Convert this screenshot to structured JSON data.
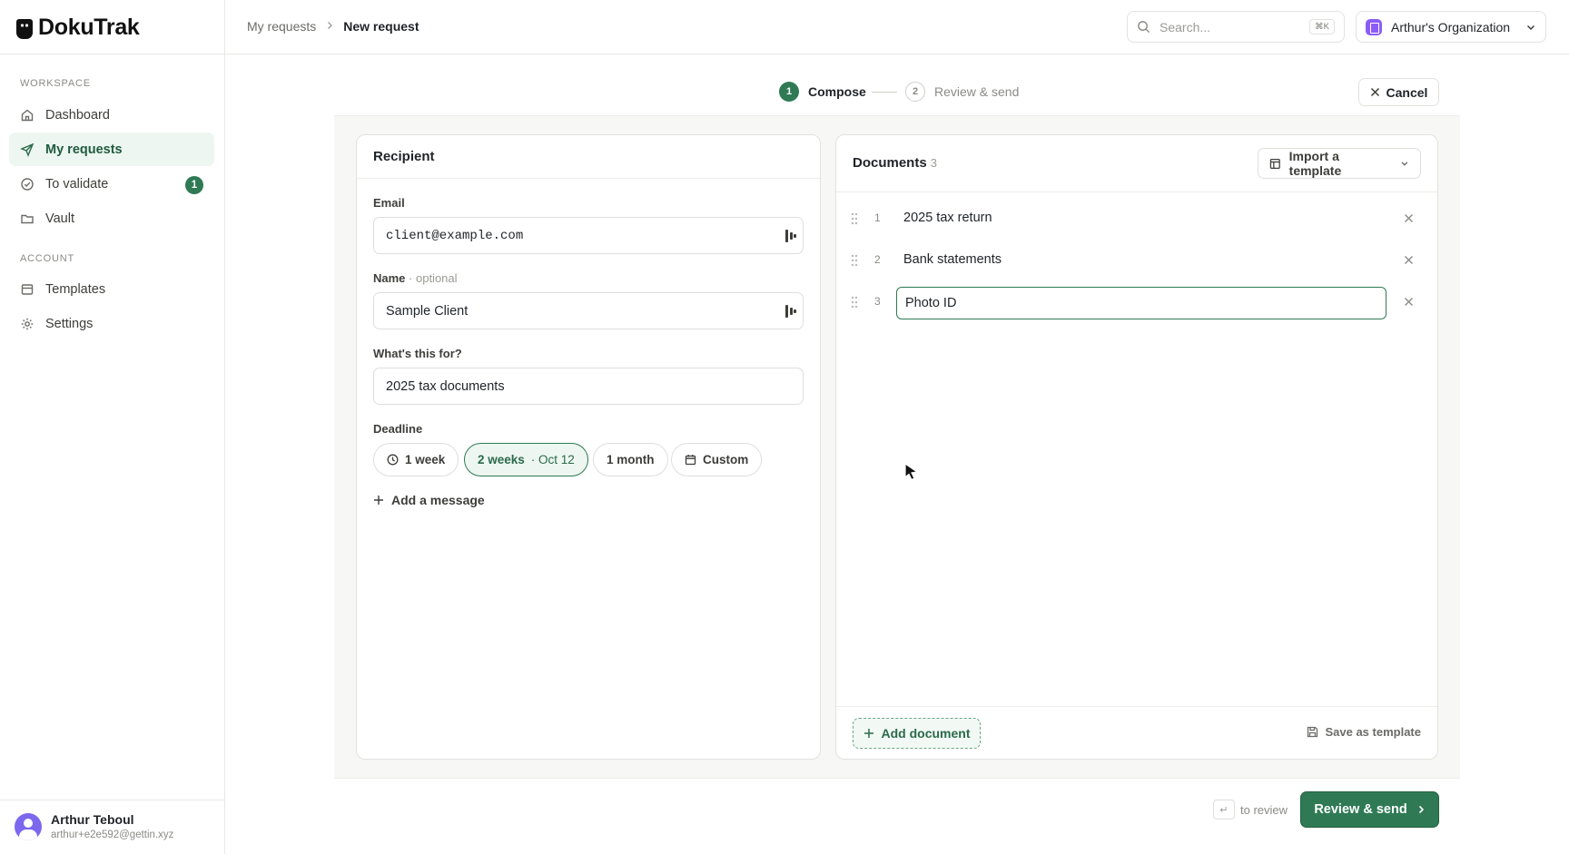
{
  "app": {
    "name": "DokuTrak"
  },
  "sidebar": {
    "workspace_label": "WORKSPACE",
    "account_label": "ACCOUNT",
    "workspace_items": [
      {
        "label": "Dashboard",
        "icon": "home-icon"
      },
      {
        "label": "My requests",
        "icon": "send-icon",
        "active": true
      },
      {
        "label": "To validate",
        "icon": "check-circle-icon",
        "badge": "1"
      },
      {
        "label": "Vault",
        "icon": "folder-icon"
      }
    ],
    "account_items": [
      {
        "label": "Templates",
        "icon": "template-icon"
      },
      {
        "label": "Settings",
        "icon": "gear-icon"
      }
    ],
    "user": {
      "name": "Arthur Teboul",
      "email": "arthur+e2e592@gettin.xyz"
    }
  },
  "topbar": {
    "breadcrumb": [
      "My requests",
      "New request"
    ],
    "search": {
      "placeholder": "Search...",
      "shortcut": "⌘K"
    },
    "org": {
      "name": "Arthur's Organization"
    }
  },
  "stepper": {
    "steps": [
      {
        "num": "1",
        "label": "Compose",
        "active": true
      },
      {
        "num": "2",
        "label": "Review & send",
        "active": false
      }
    ],
    "cancel_label": "Cancel"
  },
  "recipient": {
    "title": "Recipient",
    "email": {
      "label": "Email",
      "value": "client@example.com"
    },
    "name": {
      "label": "Name",
      "optional": "· optional",
      "value": "Sample Client"
    },
    "purpose": {
      "label": "What's this for?",
      "value": "2025 tax documents"
    },
    "deadline": {
      "label": "Deadline",
      "options": [
        {
          "label": "1 week",
          "icon": "clock-icon"
        },
        {
          "label": "2 weeks",
          "sub": "· Oct 12",
          "selected": true
        },
        {
          "label": "1 month"
        },
        {
          "label": "Custom",
          "icon": "calendar-icon"
        }
      ]
    },
    "add_message_label": "Add a message"
  },
  "documents": {
    "title": "Documents",
    "count": "3",
    "import_label": "Import a template",
    "items": [
      {
        "num": "1",
        "name": "2025 tax return"
      },
      {
        "num": "2",
        "name": "Bank statements"
      },
      {
        "num": "3",
        "name": "Photo ID",
        "editing": true
      }
    ],
    "add_label": "Add document",
    "save_template_label": "Save as template"
  },
  "footer": {
    "hint_key": "↵",
    "hint_label": "to review",
    "primary_label": "Review & send"
  },
  "colors": {
    "accent": "#2f7a55",
    "accent_light": "#edf6f0",
    "org_icon": "#8b5cf6",
    "avatar": "#7b68ee"
  }
}
